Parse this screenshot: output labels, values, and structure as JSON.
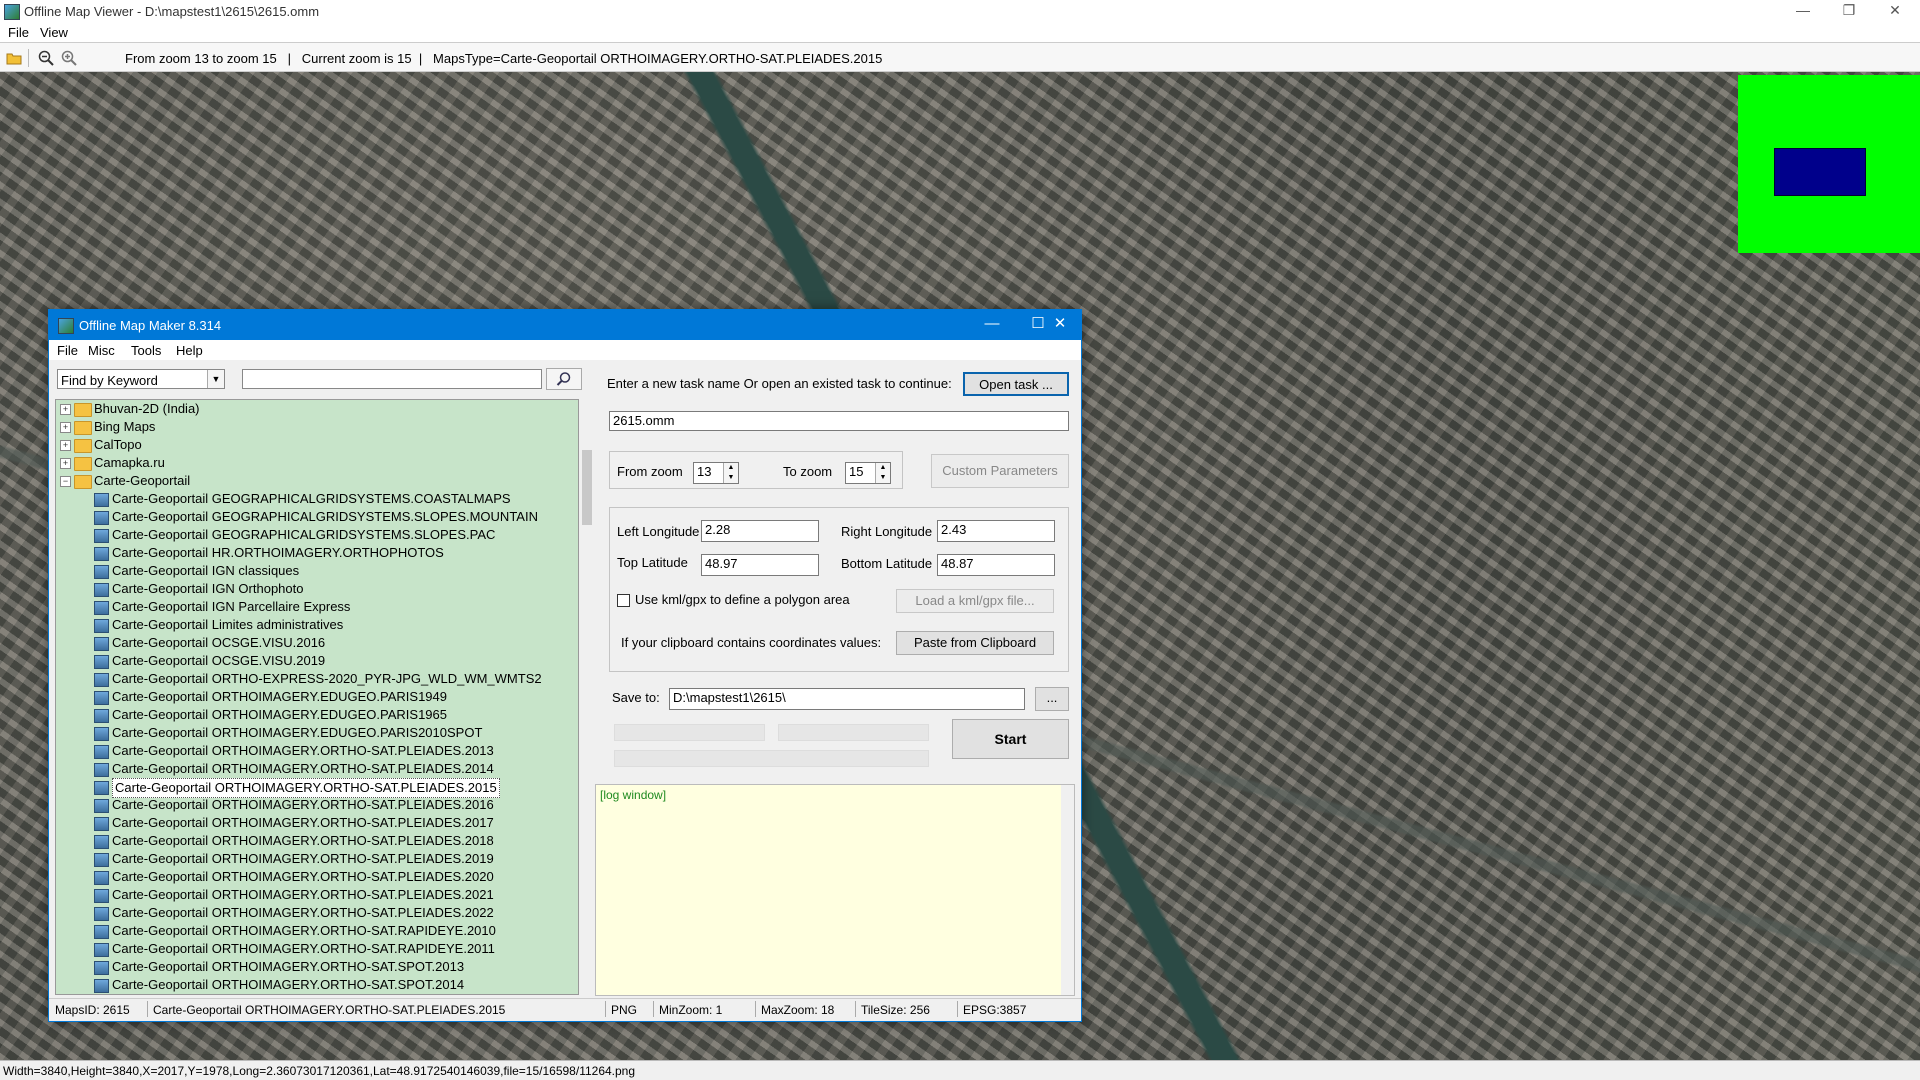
{
  "viewer": {
    "title": "Offline Map Viewer - D:\\mapstest1\\2615\\2615.omm",
    "menu": [
      "File",
      "View"
    ],
    "toolbar_info": "From zoom 13 to zoom 15   |   Current zoom is 15  |   MapsType=Carte-Geoportail ORTHOIMAGERY.ORTHO-SAT.PLEIADES.2015",
    "status": "Width=3840,Height=3840,X=2017,Y=1978,Long=2.36073017120361,Lat=48.9172540146039,file=15/16598/11264.png",
    "minimap_color": "#00ff00",
    "minimap_rect_color": "#00008b"
  },
  "dialog": {
    "title": "Offline Map Maker 8.314",
    "menu": [
      "File",
      "Misc",
      "Tools",
      "Help"
    ],
    "finder": {
      "selected": "Find by Keyword",
      "keyword": ""
    },
    "tree": {
      "folders": [
        "Bhuvan-2D (India)",
        "Bing Maps",
        "CalTopo",
        "Camapka.ru",
        "Carte-Geoportail"
      ],
      "items": [
        "Carte-Geoportail GEOGRAPHICALGRIDSYSTEMS.COASTALMAPS",
        "Carte-Geoportail GEOGRAPHICALGRIDSYSTEMS.SLOPES.MOUNTAIN",
        "Carte-Geoportail GEOGRAPHICALGRIDSYSTEMS.SLOPES.PAC",
        "Carte-Geoportail HR.ORTHOIMAGERY.ORTHOPHOTOS",
        "Carte-Geoportail IGN classiques",
        "Carte-Geoportail IGN Orthophoto",
        "Carte-Geoportail IGN Parcellaire Express",
        "Carte-Geoportail Limites administratives",
        "Carte-Geoportail OCSGE.VISU.2016",
        "Carte-Geoportail OCSGE.VISU.2019",
        "Carte-Geoportail ORTHO-EXPRESS-2020_PYR-JPG_WLD_WM_WMTS2",
        "Carte-Geoportail ORTHOIMAGERY.EDUGEO.PARIS1949",
        "Carte-Geoportail ORTHOIMAGERY.EDUGEO.PARIS1965",
        "Carte-Geoportail ORTHOIMAGERY.EDUGEO.PARIS2010SPOT",
        "Carte-Geoportail ORTHOIMAGERY.ORTHO-SAT.PLEIADES.2013",
        "Carte-Geoportail ORTHOIMAGERY.ORTHO-SAT.PLEIADES.2014",
        "Carte-Geoportail ORTHOIMAGERY.ORTHO-SAT.PLEIADES.2015",
        "Carte-Geoportail ORTHOIMAGERY.ORTHO-SAT.PLEIADES.2016",
        "Carte-Geoportail ORTHOIMAGERY.ORTHO-SAT.PLEIADES.2017",
        "Carte-Geoportail ORTHOIMAGERY.ORTHO-SAT.PLEIADES.2018",
        "Carte-Geoportail ORTHOIMAGERY.ORTHO-SAT.PLEIADES.2019",
        "Carte-Geoportail ORTHOIMAGERY.ORTHO-SAT.PLEIADES.2020",
        "Carte-Geoportail ORTHOIMAGERY.ORTHO-SAT.PLEIADES.2021",
        "Carte-Geoportail ORTHOIMAGERY.ORTHO-SAT.PLEIADES.2022",
        "Carte-Geoportail ORTHOIMAGERY.ORTHO-SAT.RAPIDEYE.2010",
        "Carte-Geoportail ORTHOIMAGERY.ORTHO-SAT.RAPIDEYE.2011",
        "Carte-Geoportail ORTHOIMAGERY.ORTHO-SAT.SPOT.2013",
        "Carte-Geoportail ORTHOIMAGERY.ORTHO-SAT.SPOT.2014"
      ],
      "selected_item": "Carte-Geoportail ORTHOIMAGERY.ORTHO-SAT.PLEIADES.2015"
    },
    "task_prompt": "Enter a new task name Or open an existed task to continue:",
    "open_task_label": "Open task ...",
    "task_name": "2615.omm",
    "from_zoom_label": "From zoom",
    "from_zoom": "13",
    "to_zoom_label": "To zoom",
    "to_zoom": "15",
    "custom_params_label": "Custom Parameters",
    "left_lon_label": "Left Longitude",
    "left_lon": "2.28",
    "right_lon_label": "Right Longitude",
    "right_lon": "2.43",
    "top_lat_label": "Top Latitude",
    "top_lat": "48.97",
    "bottom_lat_label": "Bottom Latitude",
    "bottom_lat": "48.87",
    "kml_checkbox_label": "Use kml/gpx to define a polygon area",
    "kml_checked": false,
    "load_kml_label": "Load a kml/gpx file...",
    "clipboard_text": "If your clipboard contains coordinates values:",
    "paste_label": "Paste from Clipboard",
    "save_to_label": "Save to:",
    "save_path": "D:\\mapstest1\\2615\\",
    "browse_label": "...",
    "start_label": "Start",
    "log_text": "[log window]",
    "status": {
      "maps_id": "MapsID: 2615",
      "map_name": "Carte-Geoportail ORTHOIMAGERY.ORTHO-SAT.PLEIADES.2015",
      "format": "PNG",
      "min_zoom": "MinZoom: 1",
      "max_zoom": "MaxZoom: 18",
      "tile_size": "TileSize: 256",
      "epsg": "EPSG:3857"
    }
  }
}
